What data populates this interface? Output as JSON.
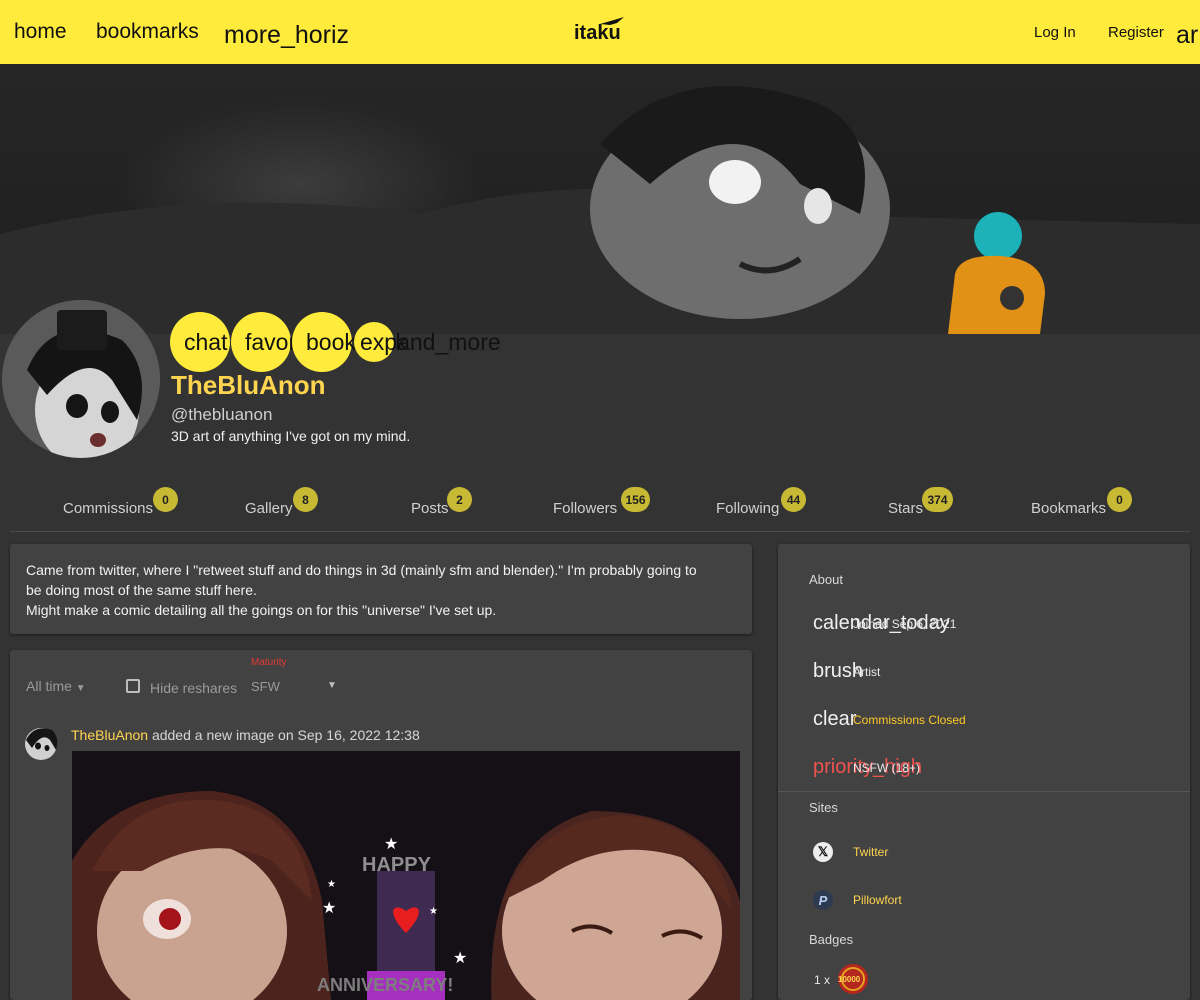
{
  "topbar": {
    "home": "home",
    "bookmarks": "bookmarks",
    "more": "more_horiz",
    "logo_text": "itaku",
    "login": "Log In",
    "register": "Register",
    "arrow": "ar"
  },
  "profile": {
    "buttons": [
      "chat",
      "favorite",
      "bookmark",
      "expand_more"
    ],
    "display_name": "TheBluAnon",
    "handle": "@thebluanon",
    "tagline": "3D art of anything I've got on my mind."
  },
  "tabs": [
    {
      "label": "Commissions",
      "count": "0"
    },
    {
      "label": "Gallery",
      "count": "8"
    },
    {
      "label": "Posts",
      "count": "2"
    },
    {
      "label": "Followers",
      "count": "156"
    },
    {
      "label": "Following",
      "count": "44"
    },
    {
      "label": "Stars",
      "count": "374"
    },
    {
      "label": "Bookmarks",
      "count": "0"
    }
  ],
  "bio": {
    "line1": "Came from twitter, where I \"retweet stuff and do things in 3d (mainly sfm and blender).\" I'm probably going to",
    "line2": "be doing most of the same stuff here.",
    "line3": "Might make a comic detailing all the goings on for this \"universe\" I've set up."
  },
  "feed": {
    "time_filter": "All time",
    "hide_reshares": "Hide reshares",
    "maturity_label": "Maturity",
    "maturity_value": "SFW",
    "post_author": "TheBluAnon",
    "post_text": "added a new image on Sep 16, 2022 12:38",
    "image_text_top": "HAPPY",
    "image_text_bottom": "ANNIVERSARY!"
  },
  "sidebar": {
    "about_heading": "About",
    "joined_icon": "calendar_today",
    "joined": "Joined Sep 6, 2021",
    "role_icon": "brush",
    "role": "Artist",
    "commissions_icon": "clear",
    "commissions": "Commissions Closed",
    "nsfw_icon": "priority_high",
    "nsfw": "NSFW (18+)",
    "sites_heading": "Sites",
    "twitter": "Twitter",
    "pillowfort": "Pillowfort",
    "badges_heading": "Badges",
    "badge_count": "1 x",
    "badge_text": "10000"
  },
  "colors": {
    "accent": "#ffeb3b",
    "badge": "#c8b935",
    "link": "#ffd54f",
    "closed": "#ffca28",
    "danger": "#ef5350",
    "card": "#424242",
    "background": "#333333"
  }
}
